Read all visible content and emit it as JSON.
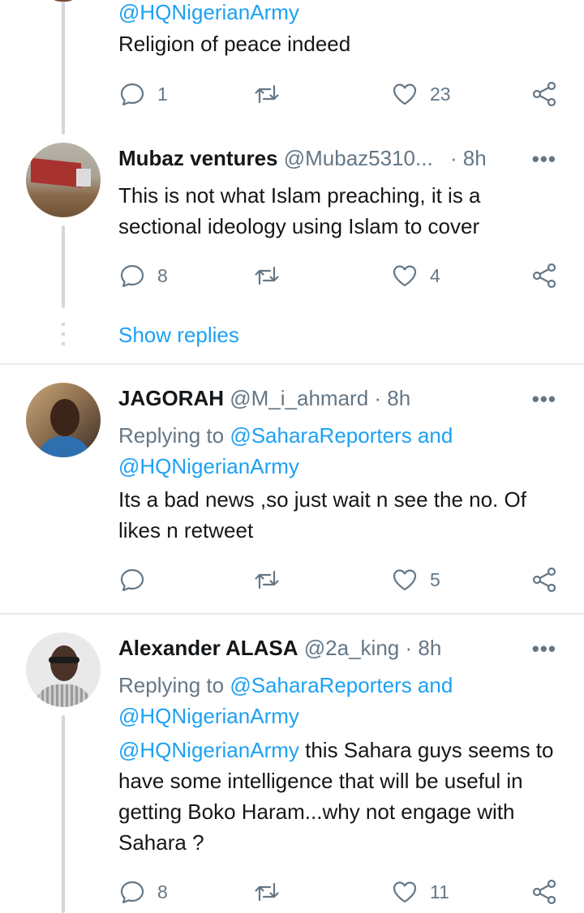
{
  "tweets": [
    {
      "reply_handle_line": "@HQNigerianArmy",
      "text": "Religion of peace indeed",
      "replies": "1",
      "likes": "23"
    },
    {
      "name": "Mubaz ventures",
      "handle": "@Mubaz5310...",
      "time": "· 8h",
      "text": "This is not what Islam preaching, it is a sectional ideology using Islam to cover",
      "replies": "8",
      "likes": "4",
      "show_replies": "Show replies"
    },
    {
      "name": "JAGORAH",
      "handle": "@M_i_ahmard · 8h",
      "replying_prefix": "Replying to",
      "replying_to": "@SaharaReporters and",
      "replying_to2": "@HQNigerianArmy",
      "text": "Its a bad news ,so just wait n see the no. Of likes n retweet",
      "likes": "5"
    },
    {
      "name": "Alexander ALASA",
      "handle": "@2a_king · 8h",
      "replying_prefix": "Replying to",
      "replying_to": "@SaharaReporters and",
      "replying_to2": "@HQNigerianArmy",
      "mention": "@HQNigerianArmy",
      "text": " this Sahara guys seems to have some intelligence that will be useful in getting Boko Haram...why not engage with Sahara ?",
      "replies": "8",
      "likes": "11"
    }
  ],
  "more_symbol": "•••",
  "icons": [
    "reply-icon",
    "retweet-icon",
    "like-icon",
    "share-icon",
    "more-icon"
  ],
  "colors": {
    "link": "#1da1f2",
    "muted": "#657786",
    "text": "#14171a",
    "thread_line": "#cfd9de"
  }
}
